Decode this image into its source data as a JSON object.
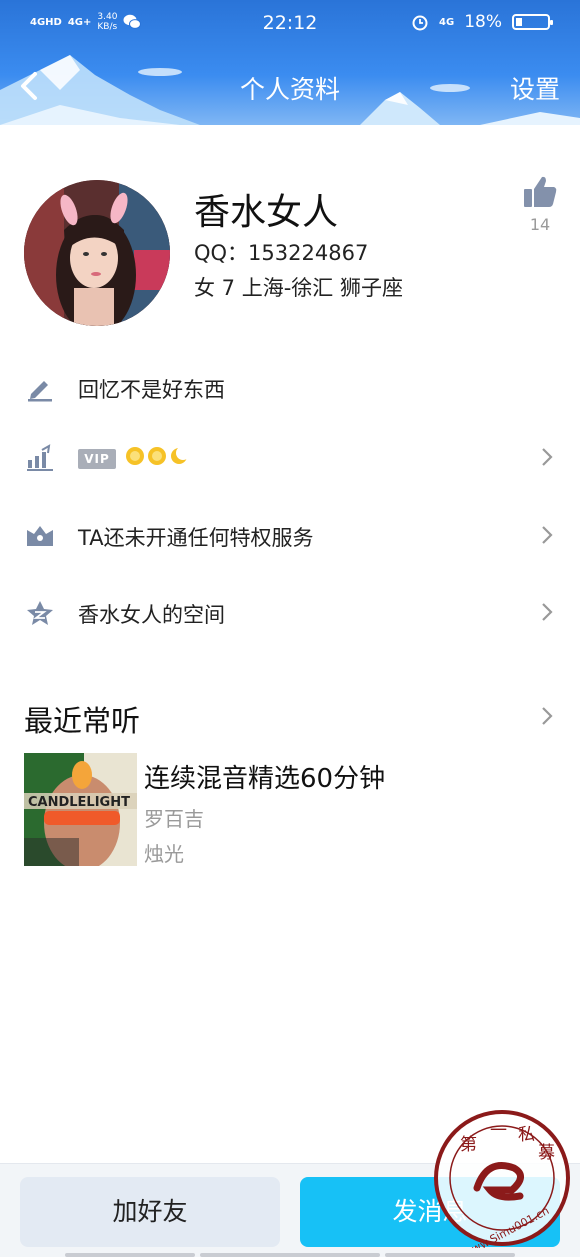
{
  "status_bar": {
    "signal1": "4GHD",
    "signal2": "4G+",
    "net_speed_value": "3.40",
    "net_speed_unit": "KB/s",
    "time": "22:12",
    "signal3": "4G",
    "battery_text": "18%"
  },
  "header": {
    "title": "个人资料",
    "settings_label": "设置"
  },
  "profile": {
    "nickname": "香水女人",
    "qq_line": "QQ：153224867",
    "info_line": "女  7  上海-徐汇  狮子座",
    "like_count": "14"
  },
  "list": {
    "signature": "回忆不是好东西",
    "vip_badge": "VIP",
    "privilege": "TA还未开通任何特权服务",
    "space": "香水女人的空间"
  },
  "recent": {
    "title": "最近常听",
    "album_text": "CANDLELIGHT",
    "song_title": "连续混音精选60分钟",
    "artist": "罗百吉",
    "album": "烛光"
  },
  "bottom": {
    "add_friend": "加好友",
    "send_message": "发消息"
  },
  "watermark": {
    "chars": [
      "第",
      "一",
      "私",
      "募"
    ],
    "url": "www.Simu001.cn"
  },
  "colors": {
    "header_blue": "#2a74d8",
    "send_button": "#17c1f6",
    "icon_gray": "#7a8aa6"
  }
}
